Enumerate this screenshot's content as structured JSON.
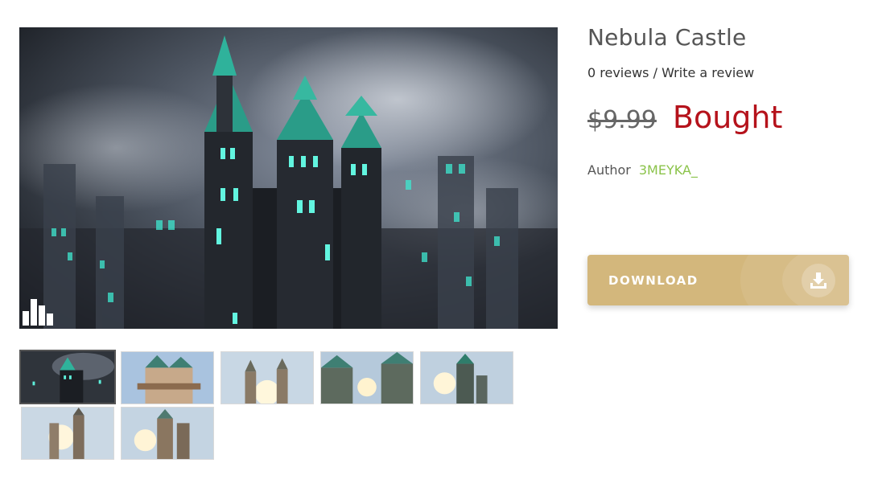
{
  "product": {
    "title": "Nebula Castle",
    "reviews_count": "0 reviews",
    "reviews_separator": " / ",
    "write_review": "Write a review",
    "old_price": "$9.99",
    "status": "Bought",
    "author_label": "Author",
    "author_name": "3MEYKA_",
    "download_label": "DOWNLOAD"
  },
  "colors": {
    "status": "#b5121b",
    "author_link": "#8bc34a",
    "download_button": "#d3b77c"
  },
  "icons": {
    "download": "download-tray-icon",
    "watermark": "city-skyline-logo"
  },
  "gallery": {
    "main_image": "Nebula Castle",
    "thumbnails": [
      {
        "name": "thumbnail-1",
        "active": true
      },
      {
        "name": "thumbnail-2",
        "active": false
      },
      {
        "name": "thumbnail-3",
        "active": false
      },
      {
        "name": "thumbnail-4",
        "active": false
      },
      {
        "name": "thumbnail-5",
        "active": false
      },
      {
        "name": "thumbnail-6",
        "active": false
      },
      {
        "name": "thumbnail-7",
        "active": false
      }
    ]
  }
}
